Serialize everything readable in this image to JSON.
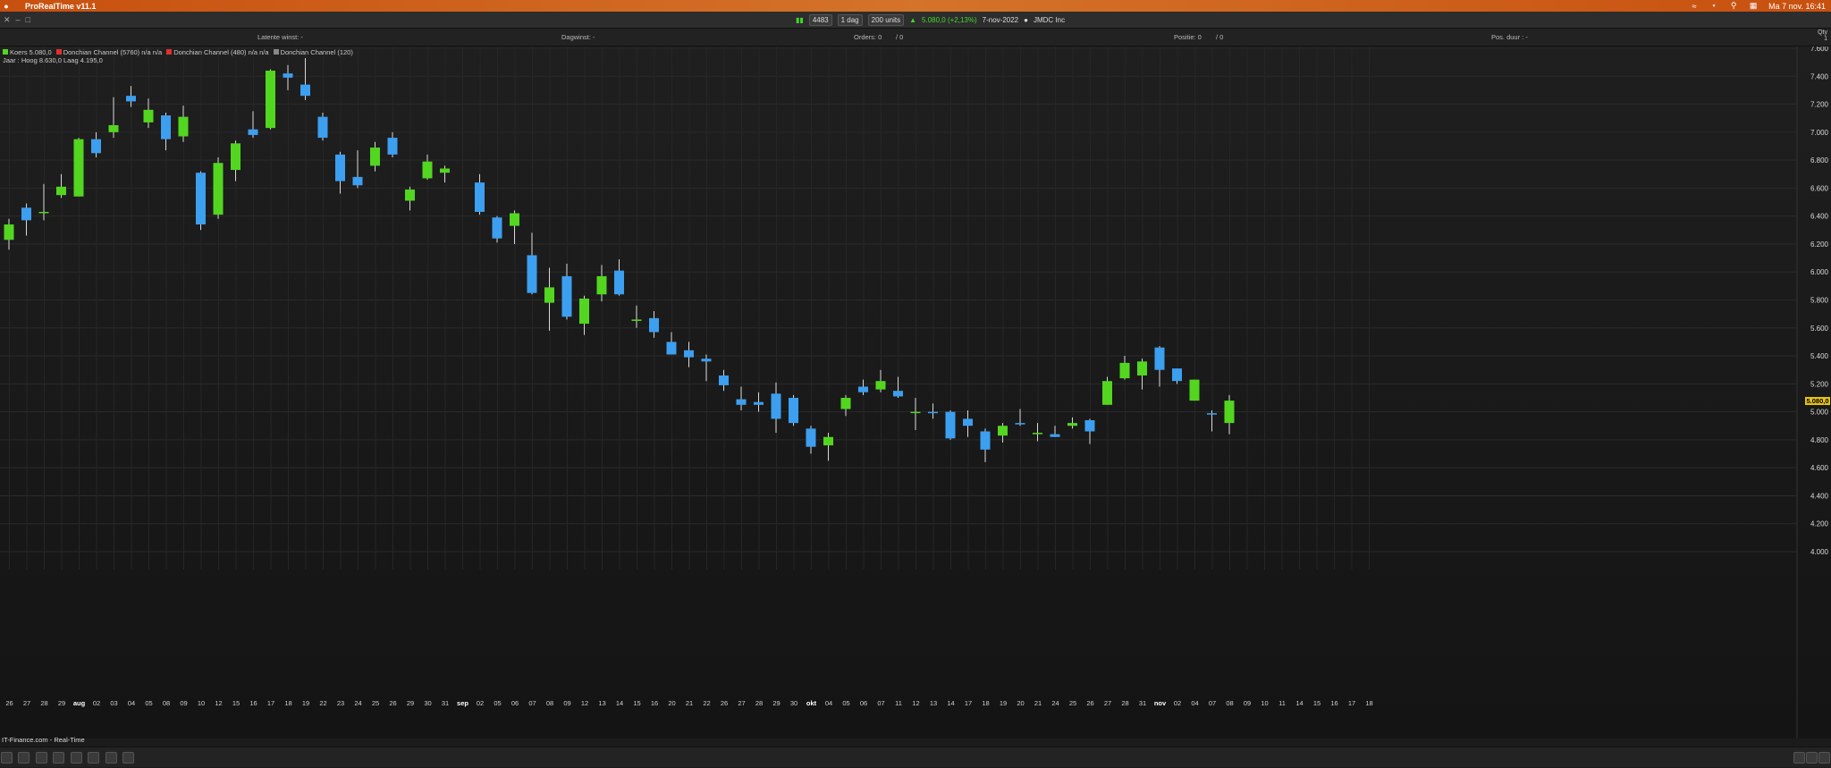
{
  "app": {
    "title": "ProRealTime v11.1",
    "datetime": "Ma 7 nov.  16:41"
  },
  "toolbar": {
    "ticker_code": "4483",
    "period": "1 dag",
    "units": "200 units",
    "price_change": "5.080,0 (+2,13%)",
    "date": "7-nov-2022",
    "instrument": "JMDC Inc"
  },
  "infobar": {
    "latent": "Latente winst: -",
    "daily": "Dagwinst: -",
    "orders": "Orders: 0",
    "orders_sep": "/ 0",
    "position": "Positie: 0",
    "position_sep": "/ 0",
    "duration": "Pos. duur : -",
    "qty_label": "Qty",
    "qty_value": "1"
  },
  "legend": {
    "koers": "Koers 5.080,0",
    "dc1": "Donchian Channel (5760) n/a n/a",
    "dc2": "Donchian Channel (480) n/a n/a",
    "dc3": "Donchian Channel (120)",
    "range": "Jaar : Hoog 8.630,0  Laag 4.195,0"
  },
  "colors": {
    "up": "#52d61f",
    "down": "#3c9ff0",
    "menubar": "#c8500f",
    "pricetag": "#e6c21a"
  },
  "source": "IT-Finance.com - Real-Time",
  "last_price_tag": "5.080,0",
  "chart_data": {
    "type": "candlestick",
    "ylim": [
      3900,
      7700
    ],
    "yticks": [
      "4.000",
      "4.200",
      "4.400",
      "4.600",
      "4.800",
      "5.000",
      "5.200",
      "5.400",
      "5.600",
      "5.800",
      "6.000",
      "6.200",
      "6.400",
      "6.600",
      "6.800",
      "7.000",
      "7.200",
      "7.400",
      "7.600"
    ],
    "ytick_values": [
      4000,
      4200,
      4400,
      4600,
      4800,
      5000,
      5200,
      5400,
      5600,
      5800,
      6000,
      6200,
      6400,
      6600,
      6800,
      7000,
      7200,
      7400,
      7600
    ],
    "xlabels": [
      "26",
      "27",
      "28",
      "29",
      "aug",
      "02",
      "03",
      "04",
      "05",
      "08",
      "09",
      "10",
      "12",
      "15",
      "16",
      "17",
      "18",
      "19",
      "22",
      "23",
      "24",
      "25",
      "26",
      "29",
      "30",
      "31",
      "sep",
      "02",
      "05",
      "06",
      "07",
      "08",
      "09",
      "12",
      "13",
      "14",
      "15",
      "16",
      "20",
      "21",
      "22",
      "26",
      "27",
      "28",
      "29",
      "30",
      "okt",
      "04",
      "05",
      "06",
      "07",
      "11",
      "12",
      "13",
      "14",
      "17",
      "18",
      "19",
      "20",
      "21",
      "24",
      "25",
      "26",
      "27",
      "28",
      "31",
      "nov",
      "02",
      "04",
      "07",
      "08",
      "09",
      "10",
      "11",
      "14",
      "15",
      "16",
      "17",
      "18"
    ],
    "candles": [
      {
        "o": 6230,
        "h": 6380,
        "l": 6160,
        "c": 6340
      },
      {
        "o": 6460,
        "h": 6490,
        "l": 6260,
        "c": 6370
      },
      {
        "o": 6430,
        "h": 6630,
        "l": 6370,
        "c": 6430
      },
      {
        "o": 6550,
        "h": 6700,
        "l": 6530,
        "c": 6610
      },
      {
        "o": 6540,
        "h": 6960,
        "l": 6540,
        "c": 6950
      },
      {
        "o": 6950,
        "h": 7000,
        "l": 6820,
        "c": 6850
      },
      {
        "o": 7000,
        "h": 7250,
        "l": 6960,
        "c": 7050
      },
      {
        "o": 7260,
        "h": 7330,
        "l": 7180,
        "c": 7220
      },
      {
        "o": 7070,
        "h": 7240,
        "l": 7030,
        "c": 7160
      },
      {
        "o": 7120,
        "h": 7140,
        "l": 6870,
        "c": 6950
      },
      {
        "o": 6970,
        "h": 7190,
        "l": 6930,
        "c": 7110
      },
      {
        "o": 6710,
        "h": 6720,
        "l": 6300,
        "c": 6340
      },
      {
        "o": 6410,
        "h": 6820,
        "l": 6380,
        "c": 6780
      },
      {
        "o": 6730,
        "h": 6940,
        "l": 6650,
        "c": 6920
      },
      {
        "o": 7020,
        "h": 7150,
        "l": 6960,
        "c": 6980
      },
      {
        "o": 7030,
        "h": 7450,
        "l": 7020,
        "c": 7440
      },
      {
        "o": 7420,
        "h": 7480,
        "l": 7300,
        "c": 7390
      },
      {
        "o": 7340,
        "h": 7530,
        "l": 7230,
        "c": 7260
      },
      {
        "o": 7110,
        "h": 7140,
        "l": 6940,
        "c": 6960
      },
      {
        "o": 6840,
        "h": 6860,
        "l": 6560,
        "c": 6650
      },
      {
        "o": 6680,
        "h": 6870,
        "l": 6600,
        "c": 6620
      },
      {
        "o": 6760,
        "h": 6930,
        "l": 6720,
        "c": 6890
      },
      {
        "o": 6960,
        "h": 7000,
        "l": 6820,
        "c": 6840
      },
      {
        "o": 6510,
        "h": 6610,
        "l": 6440,
        "c": 6590
      },
      {
        "o": 6670,
        "h": 6840,
        "l": 6660,
        "c": 6790
      },
      {
        "o": 6710,
        "h": 6760,
        "l": 6640,
        "c": 6740
      },
      {
        "o": 6640,
        "h": 6700,
        "l": 6410,
        "c": 6430
      },
      {
        "o": 6390,
        "h": 6400,
        "l": 6210,
        "c": 6240
      },
      {
        "o": 6330,
        "h": 6440,
        "l": 6200,
        "c": 6420
      },
      {
        "o": 6120,
        "h": 6280,
        "l": 5840,
        "c": 5850
      },
      {
        "o": 5780,
        "h": 6030,
        "l": 5580,
        "c": 5890
      },
      {
        "o": 5970,
        "h": 6060,
        "l": 5660,
        "c": 5680
      },
      {
        "o": 5630,
        "h": 5830,
        "l": 5550,
        "c": 5810
      },
      {
        "o": 5840,
        "h": 6050,
        "l": 5790,
        "c": 5970
      },
      {
        "o": 6010,
        "h": 6090,
        "l": 5830,
        "c": 5840
      },
      {
        "o": 5650,
        "h": 5760,
        "l": 5600,
        "c": 5660
      },
      {
        "o": 5670,
        "h": 5720,
        "l": 5530,
        "c": 5570
      },
      {
        "o": 5500,
        "h": 5570,
        "l": 5420,
        "c": 5410
      },
      {
        "o": 5440,
        "h": 5500,
        "l": 5320,
        "c": 5390
      },
      {
        "o": 5380,
        "h": 5410,
        "l": 5220,
        "c": 5360
      },
      {
        "o": 5260,
        "h": 5300,
        "l": 5150,
        "c": 5190
      },
      {
        "o": 5090,
        "h": 5180,
        "l": 5010,
        "c": 5050
      },
      {
        "o": 5070,
        "h": 5140,
        "l": 5000,
        "c": 5050
      },
      {
        "o": 5130,
        "h": 5210,
        "l": 4850,
        "c": 4950
      },
      {
        "o": 5100,
        "h": 5120,
        "l": 4900,
        "c": 4920
      },
      {
        "o": 4880,
        "h": 4900,
        "l": 4700,
        "c": 4750
      },
      {
        "o": 4760,
        "h": 4850,
        "l": 4650,
        "c": 4820
      },
      {
        "o": 5020,
        "h": 5120,
        "l": 4970,
        "c": 5100
      },
      {
        "o": 5180,
        "h": 5230,
        "l": 5120,
        "c": 5140
      },
      {
        "o": 5160,
        "h": 5300,
        "l": 5140,
        "c": 5220
      },
      {
        "o": 5150,
        "h": 5250,
        "l": 5100,
        "c": 5110
      },
      {
        "o": 5000,
        "h": 5100,
        "l": 4870,
        "c": 5000
      },
      {
        "o": 5000,
        "h": 5060,
        "l": 4950,
        "c": 4990
      },
      {
        "o": 5000,
        "h": 5010,
        "l": 4800,
        "c": 4810
      },
      {
        "o": 4950,
        "h": 5010,
        "l": 4820,
        "c": 4900
      },
      {
        "o": 4860,
        "h": 4880,
        "l": 4640,
        "c": 4730
      },
      {
        "o": 4830,
        "h": 4920,
        "l": 4780,
        "c": 4900
      },
      {
        "o": 4920,
        "h": 5020,
        "l": 4900,
        "c": 4910
      },
      {
        "o": 4840,
        "h": 4920,
        "l": 4790,
        "c": 4850
      },
      {
        "o": 4840,
        "h": 4900,
        "l": 4820,
        "c": 4820
      },
      {
        "o": 4900,
        "h": 4960,
        "l": 4880,
        "c": 4920
      },
      {
        "o": 4940,
        "h": 4950,
        "l": 4770,
        "c": 4860
      },
      {
        "o": 5050,
        "h": 5250,
        "l": 5050,
        "c": 5220
      },
      {
        "o": 5240,
        "h": 5400,
        "l": 5230,
        "c": 5350
      },
      {
        "o": 5260,
        "h": 5380,
        "l": 5160,
        "c": 5360
      },
      {
        "o": 5460,
        "h": 5470,
        "l": 5180,
        "c": 5300
      },
      {
        "o": 5310,
        "h": 5310,
        "l": 5200,
        "c": 5220
      },
      {
        "o": 5080,
        "h": 5230,
        "l": 5080,
        "c": 5230
      },
      {
        "o": 4990,
        "h": 5010,
        "l": 4860,
        "c": 4980
      },
      {
        "o": 4920,
        "h": 5120,
        "l": 4840,
        "c": 5080
      }
    ],
    "candle_x_index": [
      0,
      1,
      2,
      3,
      4,
      5,
      6,
      7,
      8,
      9,
      10,
      11,
      12,
      13,
      14,
      15,
      16,
      17,
      18,
      19,
      20,
      21,
      22,
      23,
      24,
      25,
      27,
      28,
      29,
      30,
      31,
      32,
      33,
      34,
      35,
      36,
      37,
      38,
      39,
      40,
      41,
      42,
      43,
      44,
      45,
      46,
      47,
      48,
      49,
      50,
      51,
      52,
      53,
      54,
      55,
      56,
      57,
      58,
      59,
      60,
      61,
      62,
      63,
      64,
      65,
      66,
      67,
      68,
      69,
      70
    ]
  }
}
